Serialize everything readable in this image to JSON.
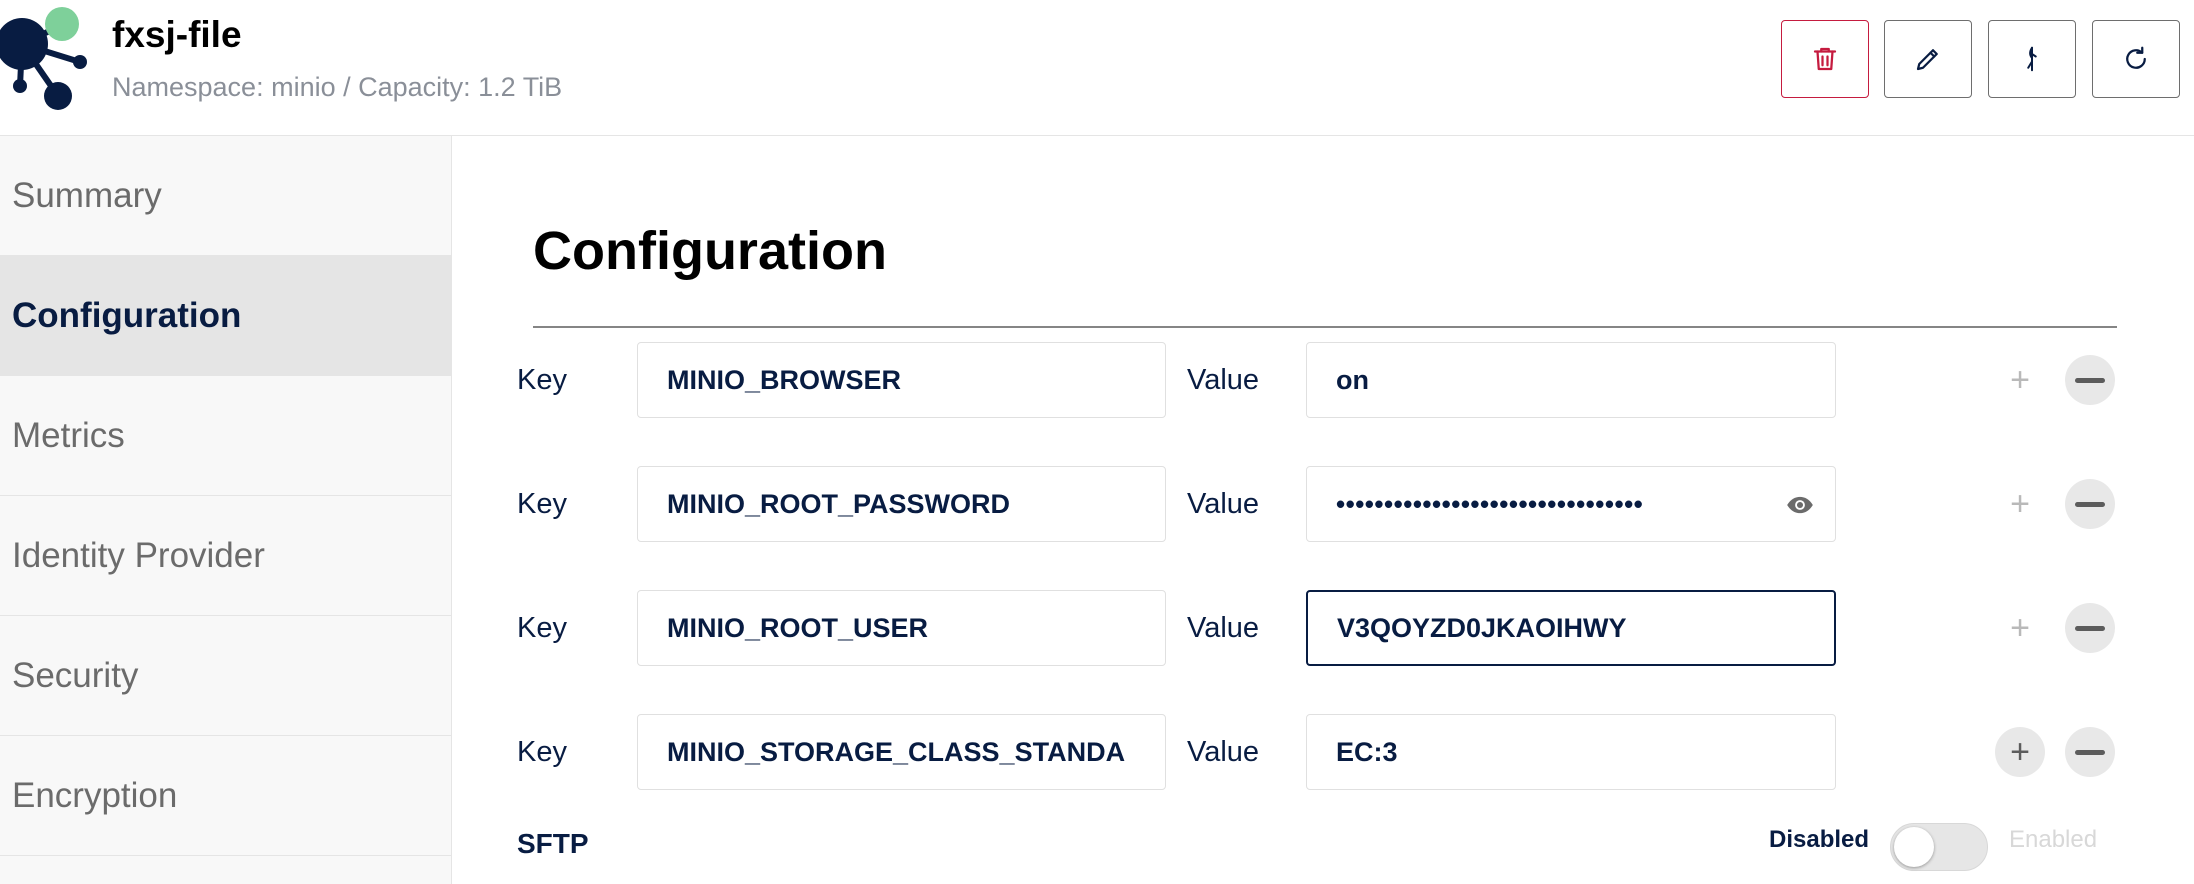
{
  "header": {
    "tenant_name": "fxsj-file",
    "subtitle": "Namespace: minio / Capacity: 1.2 TiB",
    "actions": [
      {
        "name": "delete",
        "icon": "trash-icon"
      },
      {
        "name": "edit",
        "icon": "pencil-icon"
      },
      {
        "name": "domains",
        "icon": "domain-icon"
      },
      {
        "name": "refresh",
        "icon": "refresh-icon"
      }
    ]
  },
  "sidebar": {
    "items": [
      {
        "label": "Summary"
      },
      {
        "label": "Configuration",
        "active": true
      },
      {
        "label": "Metrics"
      },
      {
        "label": "Identity Provider"
      },
      {
        "label": "Security"
      },
      {
        "label": "Encryption"
      }
    ]
  },
  "main": {
    "title": "Configuration",
    "key_label": "Key",
    "value_label": "Value",
    "rows": [
      {
        "key": "MINIO_BROWSER",
        "value": "on"
      },
      {
        "key": "MINIO_ROOT_PASSWORD",
        "value": "••••••••••••••••••••••••••••••••"
      },
      {
        "key": "MINIO_ROOT_USER",
        "value": "V3QOYZD0JKAOIHWY"
      },
      {
        "key": "MINIO_STORAGE_CLASS_STANDA",
        "value": "EC:3"
      }
    ],
    "plus_symbol": "+",
    "sftp": {
      "label": "SFTP",
      "off_label": "Disabled",
      "on_label": "Enabled",
      "enabled": false
    }
  },
  "colors": {
    "navy": "#081c42",
    "danger": "#c51b3f",
    "logo_green": "#7ed09a"
  }
}
